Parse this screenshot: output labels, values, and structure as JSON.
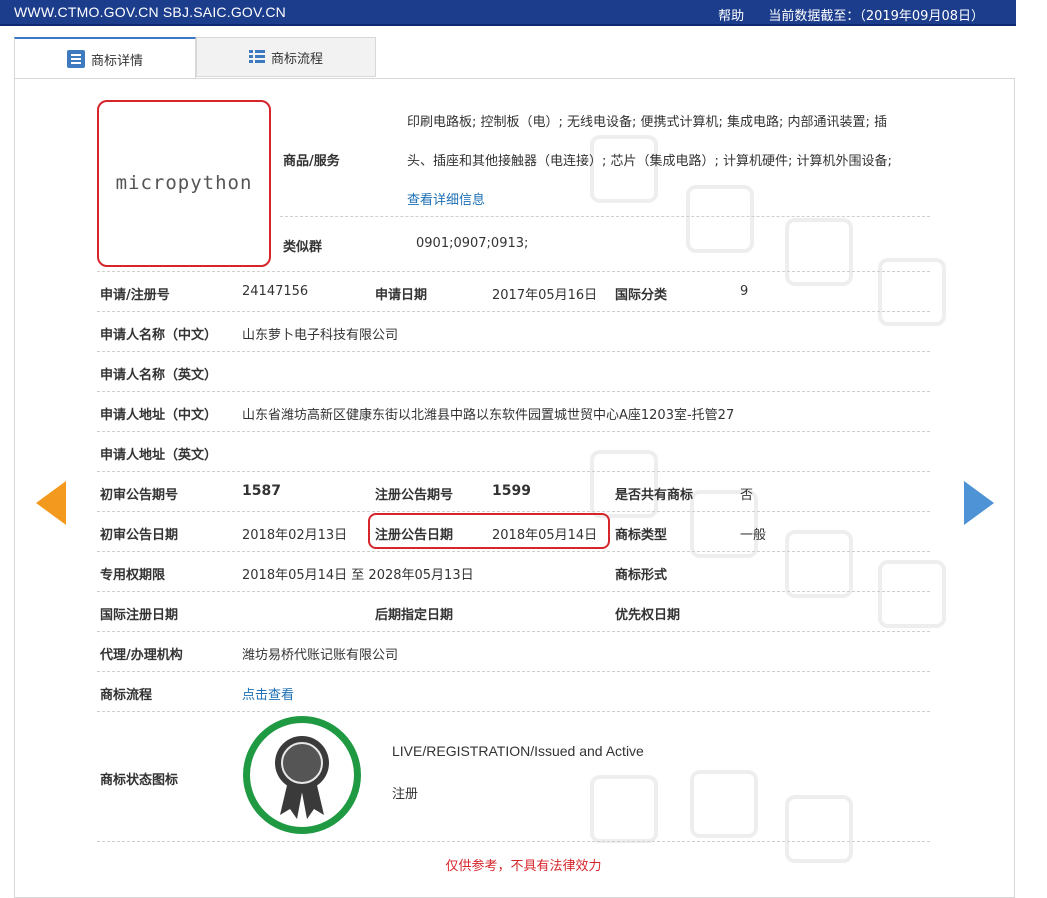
{
  "topbar": {
    "site": "WWW.CTMO.GOV.CN SBJ.SAIC.GOV.CN",
    "help": "帮助",
    "data_date": "当前数据截至：（2019年09月08日）"
  },
  "tabs": [
    {
      "label": "商标详情",
      "icon": "document-icon",
      "active": true
    },
    {
      "label": "商标流程",
      "icon": "list-icon",
      "active": false
    }
  ],
  "trademark": {
    "logo_text": "micropython",
    "goods_label": "商品/服务",
    "goods_line1": "印刷电路板; 控制板（电）; 无线电设备; 便携式计算机; 集成电路; 内部通讯装置; 插",
    "goods_line2": "头、插座和其他接触器（电连接）; 芯片（集成电路）; 计算机硬件; 计算机外围设备;",
    "goods_more": "查看详细信息",
    "similar_label": "类似群",
    "similar_value": "0901;0907;0913;"
  },
  "fields": {
    "reg_no_label": "申请/注册号",
    "reg_no": "24147156",
    "apply_date_label": "申请日期",
    "apply_date": "2017年05月16日",
    "intl_class_label": "国际分类",
    "intl_class": "9",
    "applicant_cn_label": "申请人名称（中文）",
    "applicant_cn": "山东萝卜电子科技有限公司",
    "applicant_en_label": "申请人名称（英文）",
    "applicant_en": "",
    "address_cn_label": "申请人地址（中文）",
    "address_cn": "山东省潍坊高新区健康东街以北潍县中路以东软件园置城世贸中心A座1203室-托管27",
    "address_en_label": "申请人地址（英文）",
    "address_en": "",
    "prelim_no_label": "初审公告期号",
    "prelim_no": "1587",
    "reg_pub_no_label": "注册公告期号",
    "reg_pub_no": "1599",
    "shared_label": "是否共有商标",
    "shared": "否",
    "prelim_date_label": "初审公告日期",
    "prelim_date": "2018年02月13日",
    "reg_pub_date_label": "注册公告日期",
    "reg_pub_date": "2018年05月14日",
    "tm_type_label": "商标类型",
    "tm_type": "一般",
    "exclusive_label": "专用权期限",
    "exclusive": "2018年05月14日 至 2028年05月13日",
    "tm_form_label": "商标形式",
    "tm_form": "",
    "intl_reg_date_label": "国际注册日期",
    "later_date_label": "后期指定日期",
    "priority_date_label": "优先权日期",
    "agent_label": "代理/办理机构",
    "agent": "潍坊易桥代账记账有限公司",
    "process_label": "商标流程",
    "process_link": "点击查看",
    "status_label": "商标状态图标",
    "status_en": "LIVE/REGISTRATION/Issued and Active",
    "status_cn": "注册"
  },
  "footer": {
    "note": "仅供参考，不具有法律效力"
  },
  "colors": {
    "topbar": "#1c3d8c",
    "highlight": "#d6262b",
    "link": "#1c6fb5",
    "status_ring": "#1f9a43",
    "prev_arrow": "#f39a1e",
    "next_arrow": "#4e93d6"
  }
}
